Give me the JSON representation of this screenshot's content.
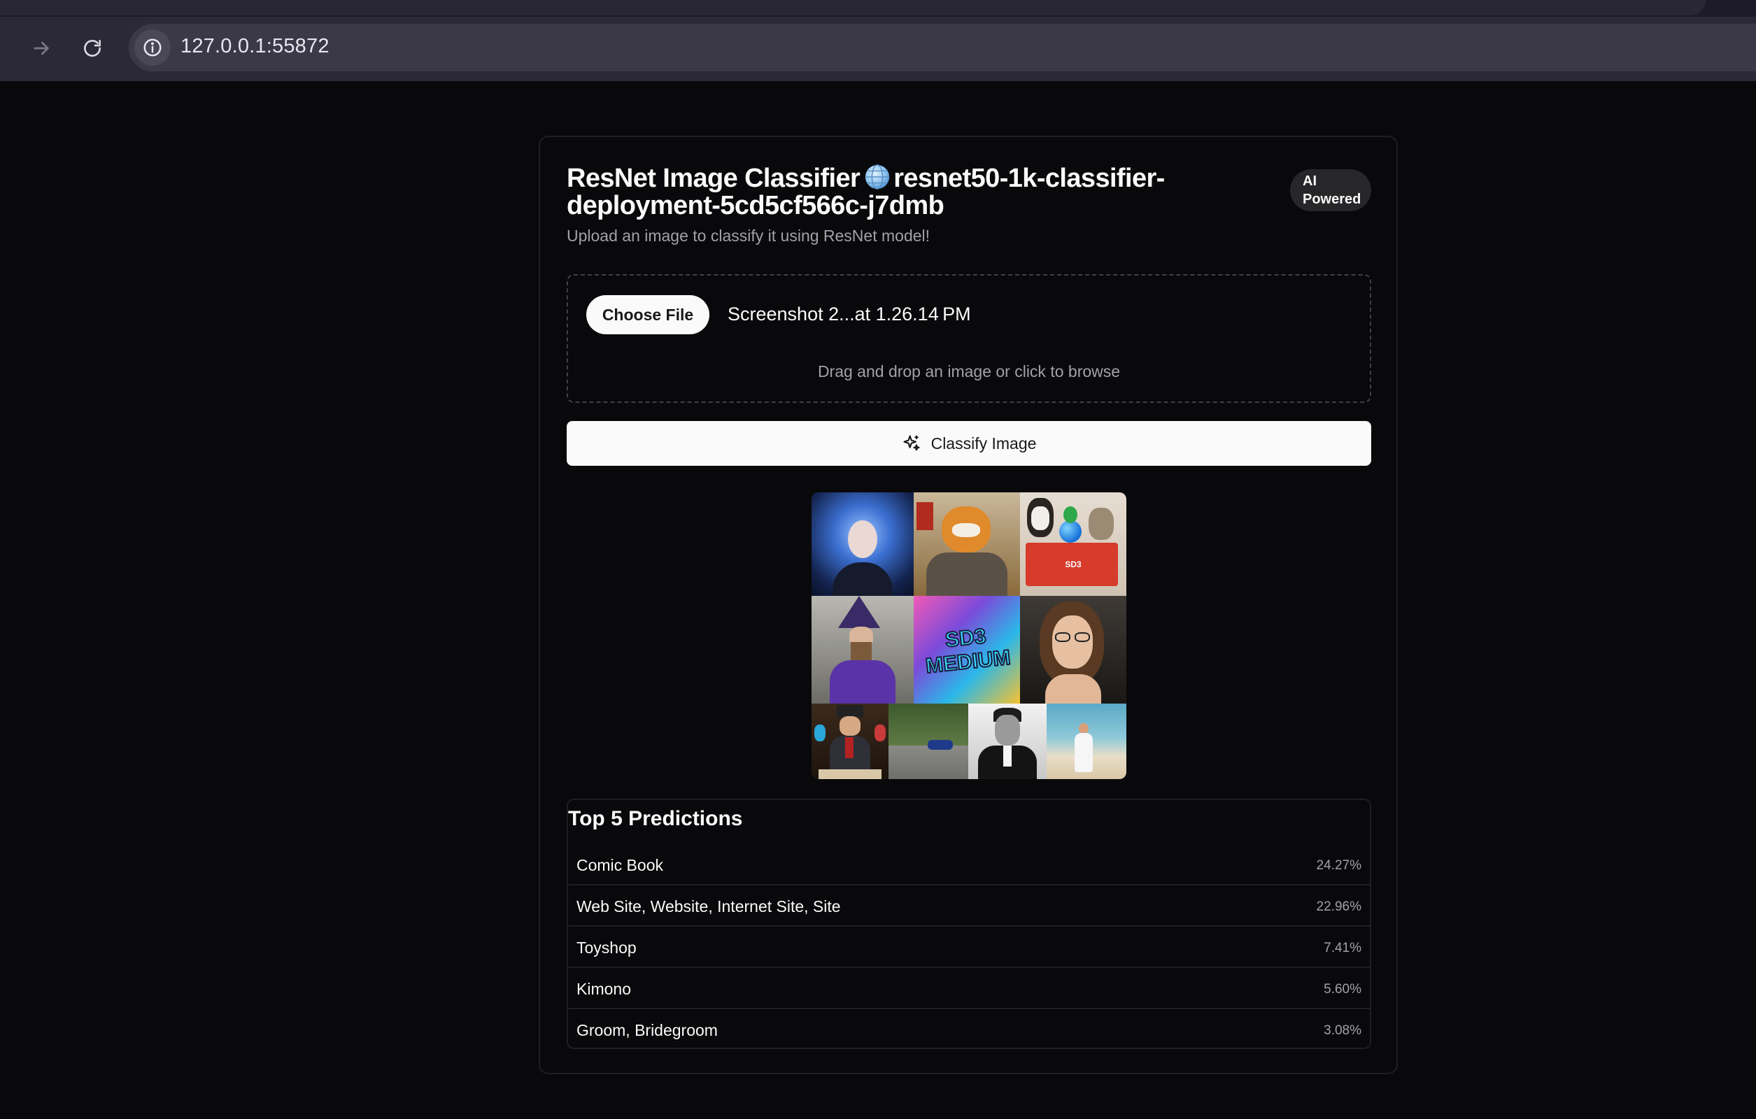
{
  "browser": {
    "url": "127.0.0.1:55872"
  },
  "app": {
    "title": "ResNet Image Classifier",
    "deployment": "resnet50-1k-classifier-deployment-5cd5cf566c-j7dmb",
    "badge": "AI Powered",
    "subtitle": "Upload an image to classify it using ResNet model!"
  },
  "upload": {
    "choose_label": "Choose File",
    "file_name": "Screenshot 2...at 1.26.14 PM",
    "hint": "Drag and drop an image or click to browse"
  },
  "classify": {
    "label": "Classify Image",
    "icon": "sparkles-icon"
  },
  "preview": {
    "tile_text_sd3": "SD3",
    "tile_text_sd3_medium": "SD3 MEDIUM"
  },
  "predictions": {
    "title": "Top 5 Predictions",
    "items": [
      {
        "label": "Comic Book",
        "score": "24.27%"
      },
      {
        "label": "Web Site, Website, Internet Site, Site",
        "score": "22.96%"
      },
      {
        "label": "Toyshop",
        "score": "7.41%"
      },
      {
        "label": "Kimono",
        "score": "5.60%"
      },
      {
        "label": "Groom, Bridegroom",
        "score": "3.08%"
      }
    ]
  },
  "colors": {
    "background": "#09090b",
    "card_border": "#1f1f23",
    "button_bg": "#fafafa",
    "muted_text": "#a1a1aa"
  }
}
